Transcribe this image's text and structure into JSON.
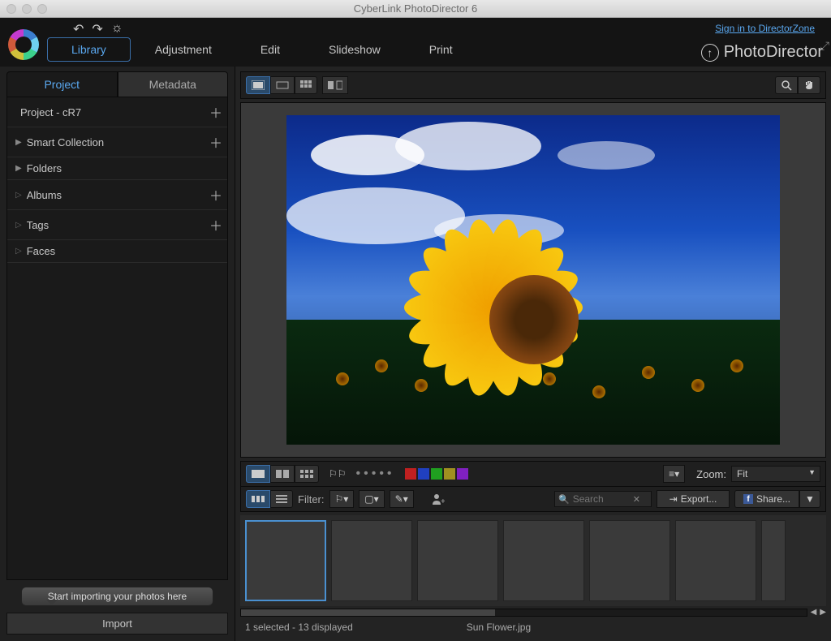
{
  "titlebar": {
    "title": "CyberLink PhotoDirector 6"
  },
  "header": {
    "tabs": [
      "Library",
      "Adjustment",
      "Edit",
      "Slideshow",
      "Print"
    ],
    "active_tab": 0,
    "signin": "Sign in to DirectorZone",
    "brand": "PhotoDirector"
  },
  "sidebar": {
    "tabs": [
      "Project",
      "Metadata"
    ],
    "active_tab": 0,
    "tree": [
      {
        "label": "Project - cR7",
        "arrow": "",
        "plus": true
      },
      {
        "label": "Smart Collection",
        "arrow": "▶",
        "plus": true
      },
      {
        "label": "Folders",
        "arrow": "▶",
        "plus": false
      },
      {
        "label": "Albums",
        "arrow": "▷",
        "plus": true
      },
      {
        "label": "Tags",
        "arrow": "▷",
        "plus": true
      },
      {
        "label": "Faces",
        "arrow": "▷",
        "plus": false
      }
    ],
    "import_hint": "Start importing your photos here",
    "import_btn": "Import"
  },
  "toolbar": {
    "zoom_label": "Zoom:",
    "zoom_value": "Fit"
  },
  "strip": {
    "filter_label": "Filter:",
    "search_placeholder": "Search",
    "export_label": "Export...",
    "share_label": "Share...",
    "colors": [
      "#c02020",
      "#2040c0",
      "#20a020",
      "#c0a020",
      "#8020c0"
    ]
  },
  "status": {
    "selection": "1 selected - 13 displayed",
    "filename": "Sun Flower.jpg"
  }
}
